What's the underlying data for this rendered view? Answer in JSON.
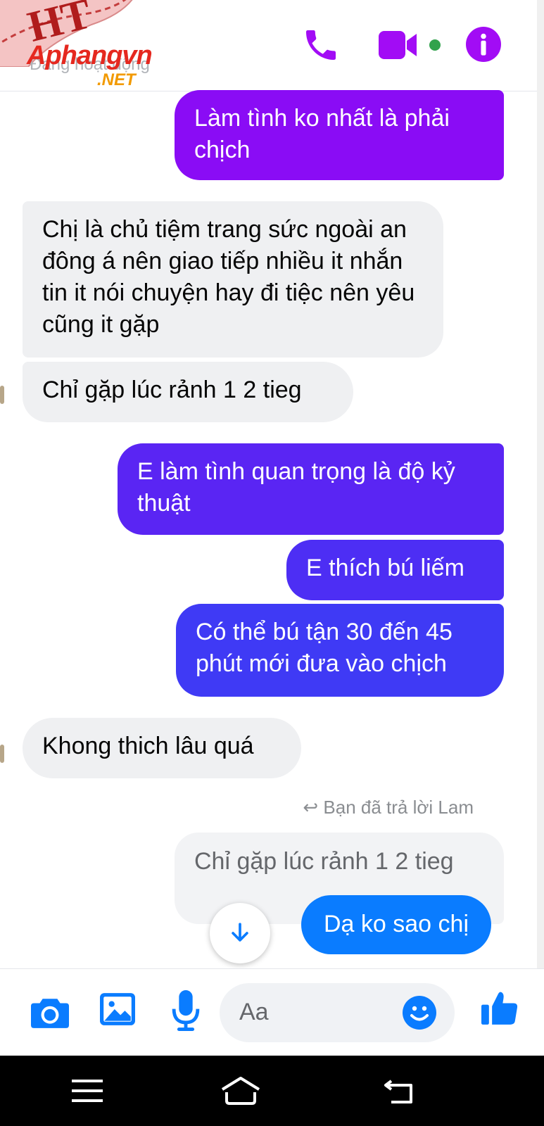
{
  "header": {
    "status": "Đang hoạt động",
    "watermark_badge": "HT",
    "watermark_logo": "Aphangvn",
    "watermark_domain": ".NET",
    "icons": [
      "phone-icon",
      "video-icon",
      "info-icon"
    ]
  },
  "messages": [
    {
      "side": "out",
      "text": "Làm tình ko nhất là phải chịch",
      "color": "#8a0cf5"
    },
    {
      "side": "in",
      "text": "Chị là chủ tiệm trang sức ngoài an đông á nên giao tiếp nhiều it nhắn tin it nói chuyện hay đi tiệc nên yêu cũng it gặp"
    },
    {
      "side": "in",
      "text": "Chỉ gặp lúc rảnh 1 2 tieg"
    },
    {
      "side": "out",
      "text": "E làm tình quan trọng là độ kỷ thuật",
      "color": "#5a25f3"
    },
    {
      "side": "out",
      "text": "E thích bú liếm",
      "color": "#4d2ef4"
    },
    {
      "side": "out",
      "text": "Có thể bú tận 30 đến 45 phút mới đưa vào chịch",
      "color": "#3f3af5"
    },
    {
      "side": "in",
      "text": "Khong thich lâu quá"
    }
  ],
  "reply": {
    "label": "Bạn đã trả lời Lam",
    "quoted": "Chỉ gặp lúc rảnh 1 2 tieg",
    "message": "Dạ ko sao chị",
    "color": "#0a7cff"
  },
  "composer": {
    "placeholder": "Aa",
    "icons": [
      "camera-icon",
      "image-icon",
      "microphone-icon",
      "emoji-icon",
      "like-icon"
    ],
    "accent": "#0a7cff"
  },
  "navbar": {
    "icons": [
      "menu-icon",
      "home-icon",
      "back-icon"
    ]
  }
}
